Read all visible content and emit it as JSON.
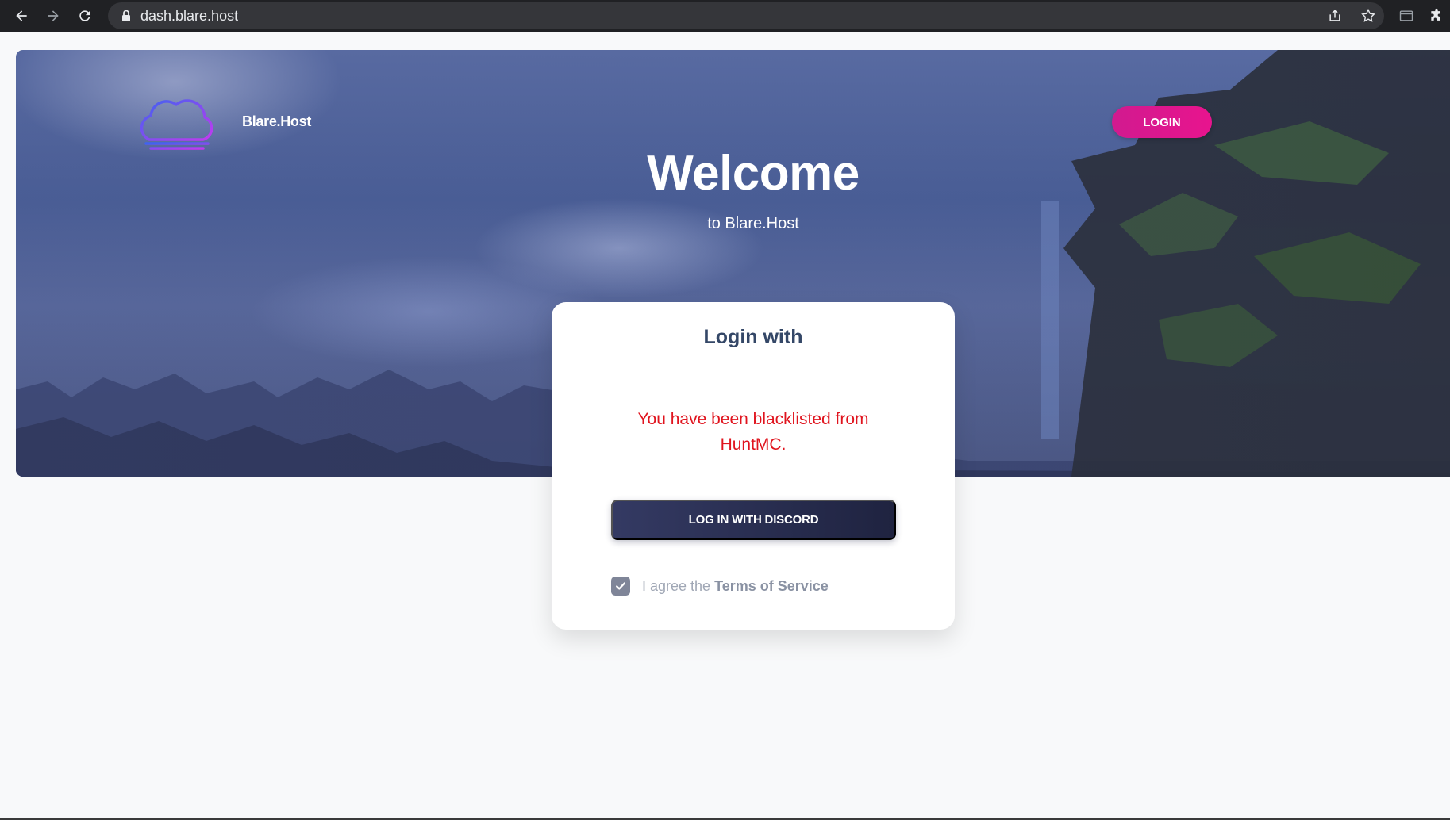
{
  "browser": {
    "url": "dash.blare.host",
    "icons": [
      "back-arrow-icon",
      "forward-arrow-icon",
      "reload-icon",
      "lock-icon",
      "share-icon",
      "star-icon",
      "side-panel-icon",
      "extensions-icon"
    ]
  },
  "header": {
    "brand_name": "Blare.Host",
    "login_label": "LOGIN",
    "logo_icon": "cloud-icon",
    "colors": {
      "login_button": "#e8148e",
      "logo_gradient_start": "#5a4cf0",
      "logo_gradient_end": "#c23af0"
    }
  },
  "hero": {
    "title": "Welcome",
    "subtitle": "to Blare.Host"
  },
  "login_card": {
    "title": "Login with",
    "error_message": "You have been blacklisted from HuntMC.",
    "discord_button_label": "LOG IN WITH DISCORD",
    "tos_prefix": "I agree the",
    "tos_link": "Terms of Service",
    "tos_checked": true,
    "colors": {
      "error": "#e0141e",
      "button": "#2a2f52"
    }
  }
}
